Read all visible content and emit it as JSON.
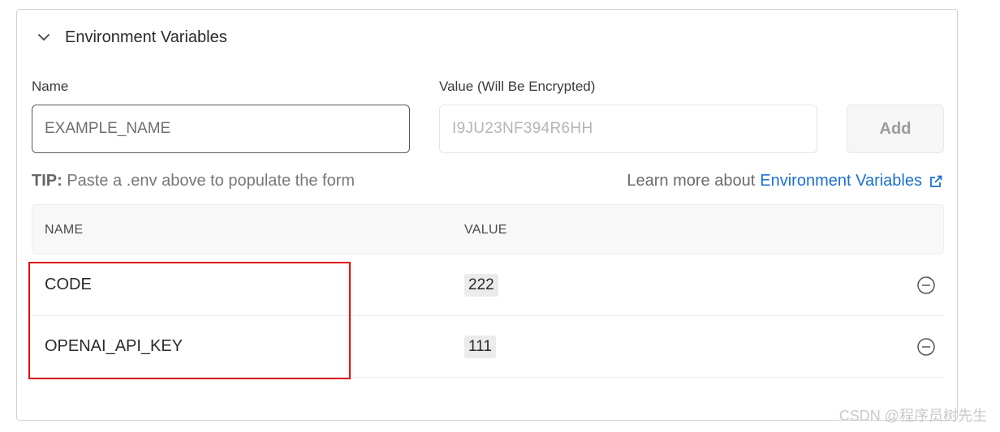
{
  "section": {
    "title": "Environment Variables",
    "chevron_icon": "chevron-down-icon"
  },
  "form": {
    "name_label": "Name",
    "name_placeholder": "EXAMPLE_NAME",
    "name_value": "",
    "value_label": "Value (Will Be Encrypted)",
    "value_placeholder": "I9JU23NF394R6HH",
    "value_value": "",
    "add_label": "Add"
  },
  "tip": {
    "prefix": "TIP:",
    "text": " Paste a .env above to populate the form"
  },
  "learn_more": {
    "text": "Learn more about",
    "link": "Environment Variables",
    "icon": "external-link-icon"
  },
  "table": {
    "columns": [
      "NAME",
      "VALUE"
    ],
    "rows": [
      {
        "name": "CODE",
        "value": "222"
      },
      {
        "name": "OPENAI_API_KEY",
        "value": "111"
      }
    ],
    "remove_icon": "minus-circle-icon"
  },
  "watermark": "CSDN @程序员树先生",
  "colors": {
    "link": "#1b6fd1",
    "highlight": "#e01010"
  }
}
